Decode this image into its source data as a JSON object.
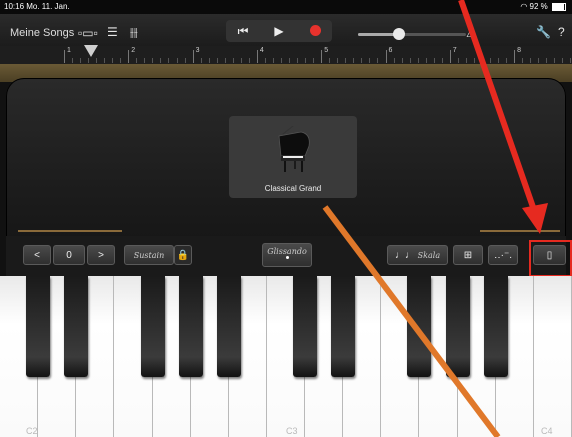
{
  "status_bar": {
    "time_date": "10:16  Mo. 11. Jan.",
    "battery": "92 %"
  },
  "control_bar": {
    "my_songs": "Meine Songs",
    "volume_level": 0.38
  },
  "ruler": {
    "bars": [
      "1",
      "2",
      "3",
      "4",
      "5",
      "6",
      "7",
      "8"
    ]
  },
  "instrument": {
    "name": "Classical Grand"
  },
  "controls": {
    "octave_down": "<",
    "octave_value": "0",
    "octave_up": ">",
    "sustain": "Sustain",
    "glissando": "Glissando",
    "scale": "Skala"
  },
  "keyboard": {
    "labels": [
      "C2",
      "C3",
      "C4"
    ]
  },
  "colors": {
    "record": "#e8322d",
    "annotation_red": "#e62a20",
    "annotation_orange": "#e0782a"
  }
}
